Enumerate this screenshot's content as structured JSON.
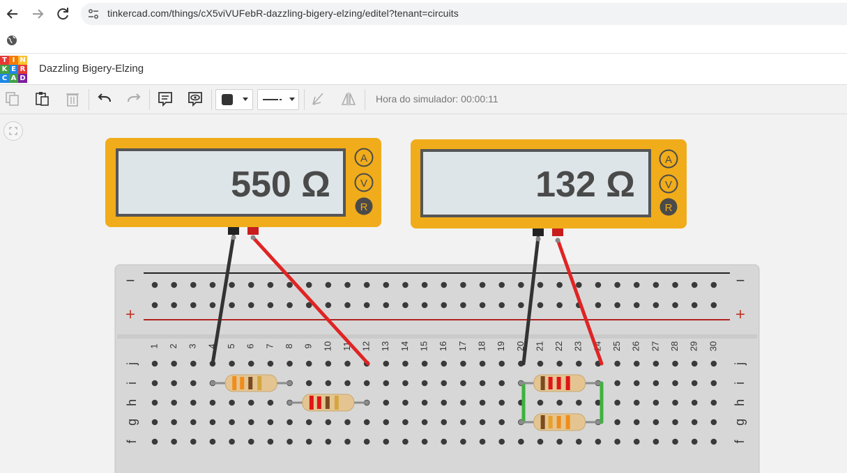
{
  "browser": {
    "url": "tinkercad.com/things/cX5viVUFebR-dazzling-bigery-elzing/editel?tenant=circuits",
    "back_icon": "arrow-left-icon",
    "forward_icon": "arrow-right-icon",
    "reload_icon": "reload-icon"
  },
  "app": {
    "logo_letters": [
      "T",
      "I",
      "N",
      "K",
      "E",
      "R",
      "C",
      "A",
      "D"
    ],
    "logo_colors": [
      "#e53935",
      "#f57c00",
      "#fbc02d",
      "#43a047",
      "#1e88e5",
      "#e53935",
      "#1e88e5",
      "#43a047",
      "#7b1fa2"
    ],
    "title": "Dazzling Bigery-Elzing"
  },
  "toolbar": {
    "simulator_time": "Hora do simulador: 00:00:11",
    "fill_color": "#333333"
  },
  "multimeters": [
    {
      "reading": "550 Ω",
      "modes": [
        "A",
        "V",
        "R"
      ],
      "active_mode": "R"
    },
    {
      "reading": "132 Ω",
      "modes": [
        "A",
        "V",
        "R"
      ],
      "active_mode": "R"
    }
  ],
  "breadboard": {
    "rail_minus": "−",
    "rail_plus": "+",
    "columns": [
      "1",
      "2",
      "3",
      "4",
      "5",
      "6",
      "7",
      "8",
      "9",
      "10",
      "11",
      "12",
      "13",
      "14",
      "15",
      "16",
      "17",
      "18",
      "19",
      "20",
      "21",
      "22",
      "23",
      "24",
      "25",
      "26",
      "27",
      "28",
      "29",
      "30"
    ],
    "rows": [
      "j",
      "i",
      "h",
      "g",
      "f"
    ]
  },
  "colors": {
    "meter_body": "#f0ac1a",
    "meter_screen": "#dde5e8",
    "probe_black": "#333333",
    "probe_red": "#e02424",
    "jumper_green": "#3db33d"
  }
}
